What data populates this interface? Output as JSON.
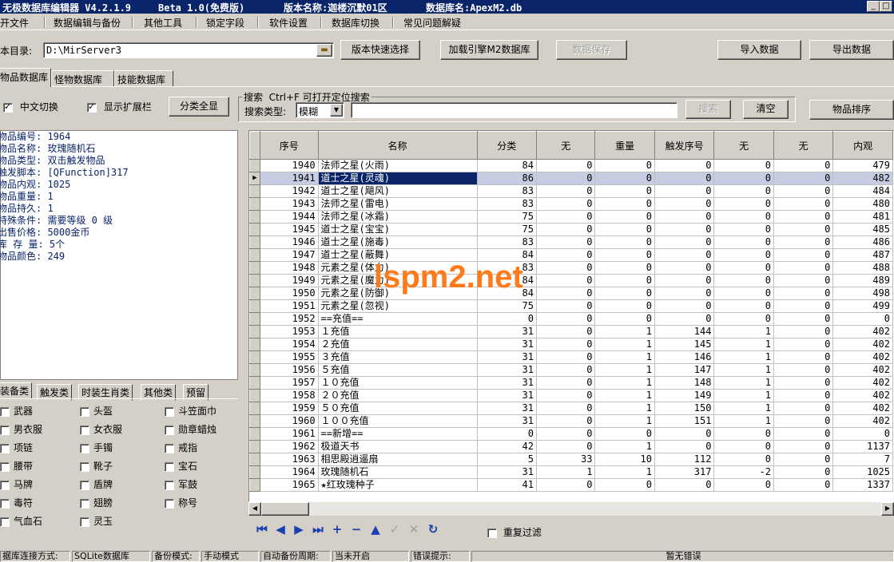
{
  "title": {
    "app": "无极数据库编辑器 V4.2.1.9",
    "beta": "Beta 1.0(免费版)",
    "version_label": "版本名称:迦楼沉默01区",
    "db_label": "数据库名:ApexM2.db"
  },
  "menu": [
    "开文件",
    "数据编辑与备份",
    "其他工具",
    "锁定字段",
    "软件设置",
    "数据库切换",
    "常见问题解疑"
  ],
  "toolbar": {
    "dir_label": "本目录:",
    "dir_value": "D:\\MirServer3",
    "quick_select": "版本快速选择",
    "load_engine": "加载引擎M2数据库",
    "save_data": "数据保存",
    "import": "导入数据",
    "export": "导出数据"
  },
  "tabs": [
    "物品数据库",
    "怪物数据库",
    "技能数据库"
  ],
  "options": {
    "chinese_switch": "中文切换",
    "show_ext": "显示扩展栏",
    "show_all": "分类全显"
  },
  "search": {
    "legend": "搜索  Ctrl+F 可打开定位搜索",
    "type_label": "搜索类型:",
    "type_value": "模糊",
    "value": "",
    "search_btn": "搜索",
    "clear_btn": "清空",
    "sort_btn": "物品排序"
  },
  "info_lines": [
    "物品编号: 1964",
    "物品名称: 玫瑰随机石",
    "物品类型: 双击触发物品",
    "触发脚本: [QFunction]317",
    "物品内观: 1025",
    "物品重量: 1",
    "物品持久: 1",
    "特殊条件: 需要等级 0 级",
    "出售价格: 5000金币",
    "库 存 量: 5个",
    "物品颜色: 249"
  ],
  "category_tabs": [
    "装备类",
    "触发类",
    "时装生肖类",
    "其他类",
    "预留"
  ],
  "categories": [
    [
      "武器",
      "头盔",
      "斗笠面巾"
    ],
    [
      "男衣服",
      "女衣服",
      "勋章蜡烛"
    ],
    [
      "项链",
      "手镯",
      "戒指"
    ],
    [
      "腰带",
      "靴子",
      "宝石"
    ],
    [
      "马牌",
      "盾牌",
      "军鼓"
    ],
    [
      "毒符",
      "翅膀",
      "称号"
    ],
    [
      "气血石",
      "灵玉",
      ""
    ]
  ],
  "grid": {
    "columns": [
      "序号",
      "名称",
      "分类",
      "无",
      "重量",
      "触发序号",
      "无",
      "无",
      "内观"
    ],
    "rows": [
      [
        "1940",
        "法师之星(火雨)",
        "84",
        "0",
        "0",
        "0",
        "0",
        "0",
        "479"
      ],
      [
        "1941",
        "道士之星(灵魂)",
        "86",
        "0",
        "0",
        "0",
        "0",
        "0",
        "482"
      ],
      [
        "1942",
        "道士之星(飓风)",
        "83",
        "0",
        "0",
        "0",
        "0",
        "0",
        "484"
      ],
      [
        "1943",
        "法师之星(雷电)",
        "83",
        "0",
        "0",
        "0",
        "0",
        "0",
        "480"
      ],
      [
        "1944",
        "法师之星(冰霜)",
        "75",
        "0",
        "0",
        "0",
        "0",
        "0",
        "481"
      ],
      [
        "1945",
        "道士之星(宝宝)",
        "75",
        "0",
        "0",
        "0",
        "0",
        "0",
        "485"
      ],
      [
        "1946",
        "道士之星(施毒)",
        "83",
        "0",
        "0",
        "0",
        "0",
        "0",
        "486"
      ],
      [
        "1947",
        "道士之星(蔽舞)",
        "84",
        "0",
        "0",
        "0",
        "0",
        "0",
        "487"
      ],
      [
        "1948",
        "元素之星(体力)",
        "83",
        "0",
        "0",
        "0",
        "0",
        "0",
        "488"
      ],
      [
        "1949",
        "元素之星(魔力)",
        "84",
        "0",
        "0",
        "0",
        "0",
        "0",
        "489"
      ],
      [
        "1950",
        "元素之星(防御)",
        "84",
        "0",
        "0",
        "0",
        "0",
        "0",
        "498"
      ],
      [
        "1951",
        "元素之星(忽视)",
        "75",
        "0",
        "0",
        "0",
        "0",
        "0",
        "499"
      ],
      [
        "1952",
        "==充值==",
        "0",
        "0",
        "0",
        "0",
        "0",
        "0",
        "0"
      ],
      [
        "1953",
        "１充值",
        "31",
        "0",
        "1",
        "144",
        "1",
        "0",
        "402"
      ],
      [
        "1954",
        "２充值",
        "31",
        "0",
        "1",
        "145",
        "1",
        "0",
        "402"
      ],
      [
        "1955",
        "３充值",
        "31",
        "0",
        "1",
        "146",
        "1",
        "0",
        "402"
      ],
      [
        "1956",
        "５充值",
        "31",
        "0",
        "1",
        "147",
        "1",
        "0",
        "402"
      ],
      [
        "1957",
        "１０充值",
        "31",
        "0",
        "1",
        "148",
        "1",
        "0",
        "402"
      ],
      [
        "1958",
        "２０充值",
        "31",
        "0",
        "1",
        "149",
        "1",
        "0",
        "402"
      ],
      [
        "1959",
        "５０充值",
        "31",
        "0",
        "1",
        "150",
        "1",
        "0",
        "402"
      ],
      [
        "1960",
        "１００充值",
        "31",
        "0",
        "1",
        "151",
        "1",
        "0",
        "402"
      ],
      [
        "1961",
        "==新增==",
        "0",
        "0",
        "0",
        "0",
        "0",
        "0",
        "0"
      ],
      [
        "1962",
        "极道天书",
        "42",
        "0",
        "1",
        "0",
        "0",
        "0",
        "1137"
      ],
      [
        "1963",
        "相思殿逍遥扇",
        "5",
        "33",
        "10",
        "112",
        "0",
        "0",
        "7"
      ],
      [
        "1964",
        "玫瑰随机石",
        "31",
        "1",
        "1",
        "317",
        "-2",
        "0",
        "1025"
      ],
      [
        "1965",
        "★红玫瑰种子",
        "41",
        "0",
        "0",
        "0",
        "0",
        "0",
        "1337"
      ]
    ]
  },
  "nav_icons": [
    "first-icon",
    "prior-icon",
    "next-icon",
    "last-icon",
    "insert-icon",
    "delete-icon",
    "edit-icon",
    "post-icon",
    "cancel-icon",
    "refresh-icon"
  ],
  "dup_filter": "重复过滤",
  "status": [
    "据库连接方式:",
    "SQLite数据库",
    "备份模式:",
    "手动模式",
    "自动备份周期:",
    "当未开启",
    "错误提示:",
    "暂无错误"
  ],
  "watermark": "lspm2.net"
}
